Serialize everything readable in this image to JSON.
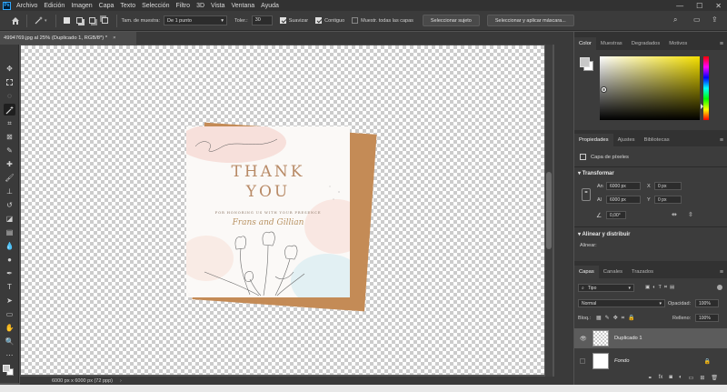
{
  "app": {
    "logo": "Ps",
    "menu": [
      "Archivo",
      "Edición",
      "Imagen",
      "Capa",
      "Texto",
      "Selección",
      "Filtro",
      "3D",
      "Vista",
      "Ventana",
      "Ayuda"
    ]
  },
  "window_controls": {
    "minimize": "—",
    "maximize": "☐",
    "close": "✕"
  },
  "options_bar": {
    "sample_size_label": "Tam. de muestra:",
    "sample_size_value": "De 1 punto",
    "tolerance_label": "Toler.:",
    "tolerance_value": "30",
    "antialias_label": "Suavizar",
    "antialias_checked": true,
    "contiguous_label": "Contiguo",
    "contiguous_checked": true,
    "all_layers_label": "Muestr. todas las capas",
    "all_layers_checked": false,
    "select_subject_button": "Seleccionar sujeto",
    "select_mask_button": "Seleccionar y aplicar máscara..."
  },
  "document": {
    "tab_title": "4994769.jpg al 25% (Duplicado 1, RGB/8*) *",
    "tab_close": "×"
  },
  "card": {
    "thank": "THANK",
    "you": "YOU",
    "subtitle": "FOR HONORING US WITH YOUR PRESENCE",
    "names": "Frans and Gillian"
  },
  "status": {
    "doc_size": "6000 px x 6000 px (72 ppp)",
    "arrow": "›"
  },
  "color_panel": {
    "tabs": [
      "Color",
      "Muestras",
      "Degradados",
      "Motivos"
    ],
    "active_tab": 0,
    "foreground": "#c8c8c8",
    "background": "#ffffff"
  },
  "properties_panel": {
    "tabs": [
      "Propiedades",
      "Ajustes",
      "Bibliotecas"
    ],
    "active_tab": 0,
    "layer_type": "Capa de píxeles",
    "transform_section": "Transformar",
    "width_label": "An",
    "width_value": "6000 px",
    "height_label": "Al",
    "height_value": "6000 px",
    "x_label": "X",
    "x_value": "0 px",
    "y_label": "Y",
    "y_value": "0 px",
    "angle_value": "0,00°",
    "align_section": "Alinear y distribuir",
    "align_sub": "Alinear:"
  },
  "layers_panel": {
    "tabs": [
      "Capas",
      "Canales",
      "Trazados"
    ],
    "active_tab": 0,
    "filter_value": "Tipo",
    "blend_mode": "Normal",
    "opacity_label": "Opacidad:",
    "opacity_value": "100%",
    "lock_label": "Bloq.:",
    "fill_label": "Relleno:",
    "fill_value": "100%",
    "layers": [
      {
        "name": "Duplicado 1",
        "selected": true,
        "visible": true
      },
      {
        "name": "Fondo",
        "selected": false,
        "visible": false,
        "locked": true
      }
    ]
  }
}
